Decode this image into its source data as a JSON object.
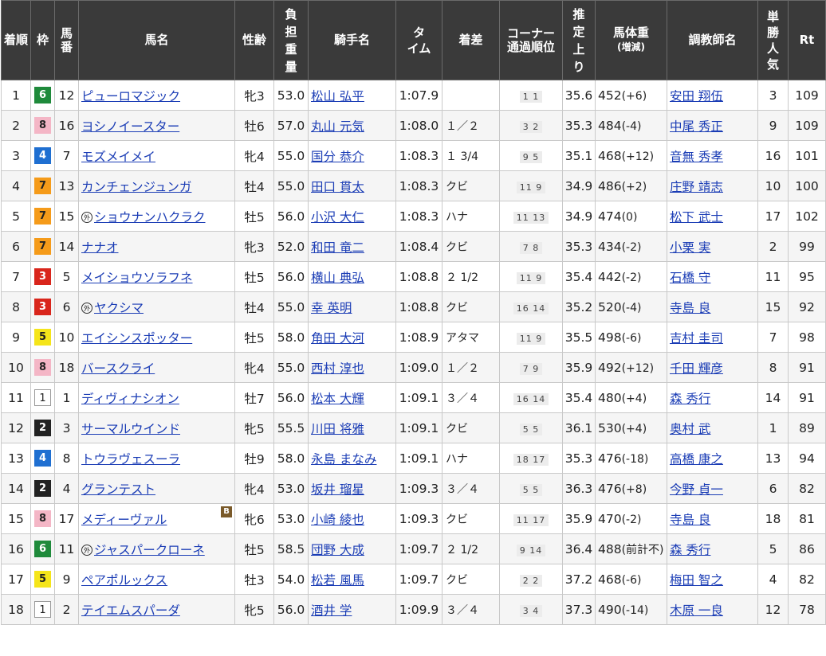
{
  "headers": {
    "chakujun": "着順",
    "waku": "枠",
    "umaban": "馬番",
    "bamei": "馬名",
    "seirei": "性齢",
    "futan": "負担重量",
    "kishu": "騎手名",
    "time": "タイム",
    "chakusa": "着差",
    "corner_line1": "コーナー",
    "corner_line2": "通過順位",
    "agari": "推定上り",
    "bataiju_main": "馬体重",
    "bataiju_sub": "(増減)",
    "choukyoushi": "調教師名",
    "ninki": "単勝人気",
    "rt": "Rt"
  },
  "icons": {
    "foreign_mark": "外",
    "blinker_mark": "B"
  },
  "colors": {
    "header_bg": "#3a3a3a",
    "link": "#1a3cb5",
    "waku_1": "#ffffff",
    "waku_2": "#222222",
    "waku_3": "#d9261c",
    "waku_4": "#1f6fd1",
    "waku_5": "#f5e51a",
    "waku_6": "#1f8a3b",
    "waku_7": "#f59b1a",
    "waku_8": "#f4b6c6"
  },
  "rows": [
    {
      "pos": "1",
      "waku": "6",
      "num": "12",
      "name": "ピューロマジック",
      "foreign": false,
      "blinker": false,
      "sex_age": "牝3",
      "weight": "53.0",
      "jockey": "松山 弘平",
      "time": "1:07.9",
      "margin": "",
      "corner": "1 1",
      "agari": "35.6",
      "bw": "452",
      "bw_diff": "(+6)",
      "trainer": "安田 翔伍",
      "pop": "3",
      "rt": "109"
    },
    {
      "pos": "2",
      "waku": "8",
      "num": "16",
      "name": "ヨシノイースター",
      "foreign": false,
      "blinker": false,
      "sex_age": "牡6",
      "weight": "57.0",
      "jockey": "丸山 元気",
      "time": "1:08.0",
      "margin": "１／２",
      "corner": "3 2",
      "agari": "35.3",
      "bw": "484",
      "bw_diff": "(-4)",
      "trainer": "中尾 秀正",
      "pop": "9",
      "rt": "109"
    },
    {
      "pos": "3",
      "waku": "4",
      "num": "7",
      "name": "モズメイメイ",
      "foreign": false,
      "blinker": false,
      "sex_age": "牝4",
      "weight": "55.0",
      "jockey": "国分 恭介",
      "time": "1:08.3",
      "margin": "１ 3/4",
      "corner": "9 5",
      "agari": "35.1",
      "bw": "468",
      "bw_diff": "(+12)",
      "trainer": "音無 秀孝",
      "pop": "16",
      "rt": "101"
    },
    {
      "pos": "4",
      "waku": "7",
      "num": "13",
      "name": "カンチェンジュンガ",
      "foreign": false,
      "blinker": false,
      "sex_age": "牡4",
      "weight": "55.0",
      "jockey": "田口 貫太",
      "time": "1:08.3",
      "margin": "クビ",
      "corner": "11 9",
      "agari": "34.9",
      "bw": "486",
      "bw_diff": "(+2)",
      "trainer": "庄野 靖志",
      "pop": "10",
      "rt": "100"
    },
    {
      "pos": "5",
      "waku": "7",
      "num": "15",
      "name": "ショウナンハクラク",
      "foreign": true,
      "blinker": false,
      "sex_age": "牡5",
      "weight": "56.0",
      "jockey": "小沢 大仁",
      "time": "1:08.3",
      "margin": "ハナ",
      "corner": "11 13",
      "agari": "34.9",
      "bw": "474",
      "bw_diff": "(0)",
      "trainer": "松下 武士",
      "pop": "17",
      "rt": "102"
    },
    {
      "pos": "6",
      "waku": "7",
      "num": "14",
      "name": "ナナオ",
      "foreign": false,
      "blinker": false,
      "sex_age": "牝3",
      "weight": "52.0",
      "jockey": "和田 竜二",
      "time": "1:08.4",
      "margin": "クビ",
      "corner": "7 8",
      "agari": "35.3",
      "bw": "434",
      "bw_diff": "(-2)",
      "trainer": "小栗 実",
      "pop": "2",
      "rt": "99"
    },
    {
      "pos": "7",
      "waku": "3",
      "num": "5",
      "name": "メイショウソラフネ",
      "foreign": false,
      "blinker": false,
      "sex_age": "牡5",
      "weight": "56.0",
      "jockey": "横山 典弘",
      "time": "1:08.8",
      "margin": "２ 1/2",
      "corner": "11 9",
      "agari": "35.4",
      "bw": "442",
      "bw_diff": "(-2)",
      "trainer": "石橋 守",
      "pop": "11",
      "rt": "95"
    },
    {
      "pos": "8",
      "waku": "3",
      "num": "6",
      "name": "ヤクシマ",
      "foreign": true,
      "blinker": false,
      "sex_age": "牡4",
      "weight": "55.0",
      "jockey": "幸 英明",
      "time": "1:08.8",
      "margin": "クビ",
      "corner": "16 14",
      "agari": "35.2",
      "bw": "520",
      "bw_diff": "(-4)",
      "trainer": "寺島 良",
      "pop": "15",
      "rt": "92"
    },
    {
      "pos": "9",
      "waku": "5",
      "num": "10",
      "name": "エイシンスポッター",
      "foreign": false,
      "blinker": false,
      "sex_age": "牡5",
      "weight": "58.0",
      "jockey": "角田 大河",
      "time": "1:08.9",
      "margin": "アタマ",
      "corner": "11 9",
      "agari": "35.5",
      "bw": "498",
      "bw_diff": "(-6)",
      "trainer": "吉村 圭司",
      "pop": "7",
      "rt": "98"
    },
    {
      "pos": "10",
      "waku": "8",
      "num": "18",
      "name": "バースクライ",
      "foreign": false,
      "blinker": false,
      "sex_age": "牝4",
      "weight": "55.0",
      "jockey": "西村 淳也",
      "time": "1:09.0",
      "margin": "１／２",
      "corner": "7 9",
      "agari": "35.9",
      "bw": "492",
      "bw_diff": "(+12)",
      "trainer": "千田 輝彦",
      "pop": "8",
      "rt": "91"
    },
    {
      "pos": "11",
      "waku": "1",
      "num": "1",
      "name": "ディヴィナシオン",
      "foreign": false,
      "blinker": false,
      "sex_age": "牡7",
      "weight": "56.0",
      "jockey": "松本 大輝",
      "time": "1:09.1",
      "margin": "３／４",
      "corner": "16 14",
      "agari": "35.4",
      "bw": "480",
      "bw_diff": "(+4)",
      "trainer": "森 秀行",
      "pop": "14",
      "rt": "91"
    },
    {
      "pos": "12",
      "waku": "2",
      "num": "3",
      "name": "サーマルウインド",
      "foreign": false,
      "blinker": false,
      "sex_age": "牝5",
      "weight": "55.5",
      "jockey": "川田 将雅",
      "time": "1:09.1",
      "margin": "クビ",
      "corner": "5 5",
      "agari": "36.1",
      "bw": "530",
      "bw_diff": "(+4)",
      "trainer": "奥村 武",
      "pop": "1",
      "rt": "89"
    },
    {
      "pos": "13",
      "waku": "4",
      "num": "8",
      "name": "トウラヴェスーラ",
      "foreign": false,
      "blinker": false,
      "sex_age": "牡9",
      "weight": "58.0",
      "jockey": "永島 まなみ",
      "time": "1:09.1",
      "margin": "ハナ",
      "corner": "18 17",
      "agari": "35.3",
      "bw": "476",
      "bw_diff": "(-18)",
      "trainer": "高橋 康之",
      "pop": "13",
      "rt": "94"
    },
    {
      "pos": "14",
      "waku": "2",
      "num": "4",
      "name": "グランテスト",
      "foreign": false,
      "blinker": false,
      "sex_age": "牝4",
      "weight": "53.0",
      "jockey": "坂井 瑠星",
      "time": "1:09.3",
      "margin": "３／４",
      "corner": "5 5",
      "agari": "36.3",
      "bw": "476",
      "bw_diff": "(+8)",
      "trainer": "今野 貞一",
      "pop": "6",
      "rt": "82"
    },
    {
      "pos": "15",
      "waku": "8",
      "num": "17",
      "name": "メディーヴァル",
      "foreign": false,
      "blinker": true,
      "sex_age": "牝6",
      "weight": "53.0",
      "jockey": "小崎 綾也",
      "time": "1:09.3",
      "margin": "クビ",
      "corner": "11 17",
      "agari": "35.9",
      "bw": "470",
      "bw_diff": "(-2)",
      "trainer": "寺島 良",
      "pop": "18",
      "rt": "81"
    },
    {
      "pos": "16",
      "waku": "6",
      "num": "11",
      "name": "ジャスパークローネ",
      "foreign": true,
      "blinker": false,
      "sex_age": "牡5",
      "weight": "58.5",
      "jockey": "団野 大成",
      "time": "1:09.7",
      "margin": "２ 1/2",
      "corner": "9 14",
      "agari": "36.4",
      "bw": "488",
      "bw_diff": "(前計不)",
      "trainer": "森 秀行",
      "pop": "5",
      "rt": "86"
    },
    {
      "pos": "17",
      "waku": "5",
      "num": "9",
      "name": "ペアポルックス",
      "foreign": false,
      "blinker": false,
      "sex_age": "牡3",
      "weight": "54.0",
      "jockey": "松若 風馬",
      "time": "1:09.7",
      "margin": "クビ",
      "corner": "2 2",
      "agari": "37.2",
      "bw": "468",
      "bw_diff": "(-6)",
      "trainer": "梅田 智之",
      "pop": "4",
      "rt": "82"
    },
    {
      "pos": "18",
      "waku": "1",
      "num": "2",
      "name": "テイエムスパーダ",
      "foreign": false,
      "blinker": false,
      "sex_age": "牝5",
      "weight": "56.0",
      "jockey": "酒井 学",
      "time": "1:09.9",
      "margin": "３／４",
      "corner": "3 4",
      "agari": "37.3",
      "bw": "490",
      "bw_diff": "(-14)",
      "trainer": "木原 一良",
      "pop": "12",
      "rt": "78"
    }
  ]
}
